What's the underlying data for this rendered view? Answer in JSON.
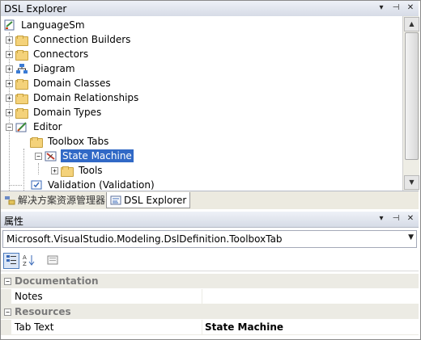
{
  "explorer": {
    "title": "DSL Explorer",
    "controls": {
      "dropdown": "▾",
      "pin": "⊣",
      "close": "✕"
    }
  },
  "tree": {
    "root": {
      "label": "LanguageSm",
      "icon": "dsl-definition-icon"
    },
    "items": [
      {
        "label": "Connection Builders",
        "icon": "folder-icon",
        "expander": "+"
      },
      {
        "label": "Connectors",
        "icon": "folder-icon",
        "expander": "+"
      },
      {
        "label": "Diagram",
        "icon": "diagram-icon",
        "expander": "+"
      },
      {
        "label": "Domain Classes",
        "icon": "folder-icon",
        "expander": "+"
      },
      {
        "label": "Domain Relationships",
        "icon": "folder-icon",
        "expander": "+"
      },
      {
        "label": "Domain Types",
        "icon": "folder-icon",
        "expander": "+"
      },
      {
        "label": "Editor",
        "icon": "editor-icon",
        "expander": "−"
      },
      {
        "label": "Toolbox Tabs",
        "icon": "folder-icon"
      },
      {
        "label": "State Machine",
        "icon": "toolbox-tab-icon",
        "expander": "−",
        "selected": true
      },
      {
        "label": "Tools",
        "icon": "folder-icon",
        "expander": "+"
      },
      {
        "label": "Validation (Validation)",
        "icon": "validation-icon"
      }
    ]
  },
  "tabs": [
    {
      "label": "解决方案资源管理器",
      "icon": "solution-explorer-icon",
      "active": false
    },
    {
      "label": "DSL Explorer",
      "icon": "dsl-explorer-icon",
      "active": true
    }
  ],
  "properties": {
    "title": "属性",
    "controls": {
      "dropdown": "▾",
      "pin": "⊣",
      "close": "✕"
    },
    "object": "Microsoft.VisualStudio.Modeling.DslDefinition.ToolboxTab",
    "toolbar": {
      "categorized": "categorized-icon",
      "alphabetical": "alphabetical-icon",
      "property_pages": "property-pages-icon"
    },
    "categories": [
      {
        "name": "Documentation",
        "expander": "−",
        "rows": [
          {
            "name": "Notes",
            "value": ""
          }
        ]
      },
      {
        "name": "Resources",
        "expander": "−",
        "rows": [
          {
            "name": "Tab Text",
            "value": "State Machine"
          }
        ]
      }
    ]
  }
}
